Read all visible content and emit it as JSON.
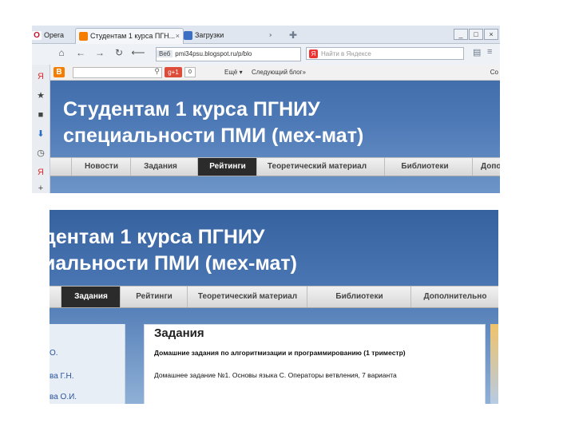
{
  "browser": {
    "tabs": [
      {
        "label": "Opera",
        "icon": "opera-icon"
      },
      {
        "label": "Студентам 1 курса ПГН...",
        "icon": "blogger-icon",
        "close": "×"
      },
      {
        "label": "Загрузки",
        "icon": "downloads-icon",
        "close": "×"
      }
    ],
    "new_tab": "✚",
    "window_buttons": [
      "_",
      "□",
      "×"
    ],
    "nav": {
      "home": "⌂",
      "back": "←",
      "forward": "→",
      "reload": "↻",
      "rewind": "⟵"
    },
    "address": {
      "label": "Веб",
      "url": "pmi34psu.blogspot.ru/p/blo"
    },
    "search_placeholder": "Найти в Яндексе",
    "side_panel_icons": [
      "yandex-icon",
      "bookmark-star-icon",
      "notes-icon",
      "downloads-icon",
      "history-icon",
      "yandex-icon",
      "add-panel-icon"
    ]
  },
  "blogger_bar": {
    "logo": "B",
    "gplus": "g+1",
    "gplus_count": "0",
    "more": "Ещё ▾",
    "next_blog": "Следующий блог»",
    "right": "Со"
  },
  "blog_title_line1": "Студентам 1 курса ПГНИУ",
  "blog_title_line2": "специальности ПМИ (мех-мат)",
  "menu1": [
    "Новости",
    "Задания",
    "Рейтинги",
    "Теоретический материал",
    "Библиотеки",
    "Допол"
  ],
  "title2_line1": "дентам 1 курса ПГНИУ",
  "title2_line2": "иальности ПМИ (мех-мат)",
  "menu2": [
    "Задания",
    "Рейтинги",
    "Теоретический материал",
    "Библиотеки",
    "Дополнительно"
  ],
  "sidebar2": [
    "О.",
    "ва Г.Н.",
    "ва О.И."
  ],
  "content2": {
    "heading": "Задания",
    "subheading": "Домашние задания по алгоритмизации и программированию (1 триместр)",
    "link": "Домашнее задание №1. Основы языка С. Операторы ветвления, 7 варианта"
  }
}
